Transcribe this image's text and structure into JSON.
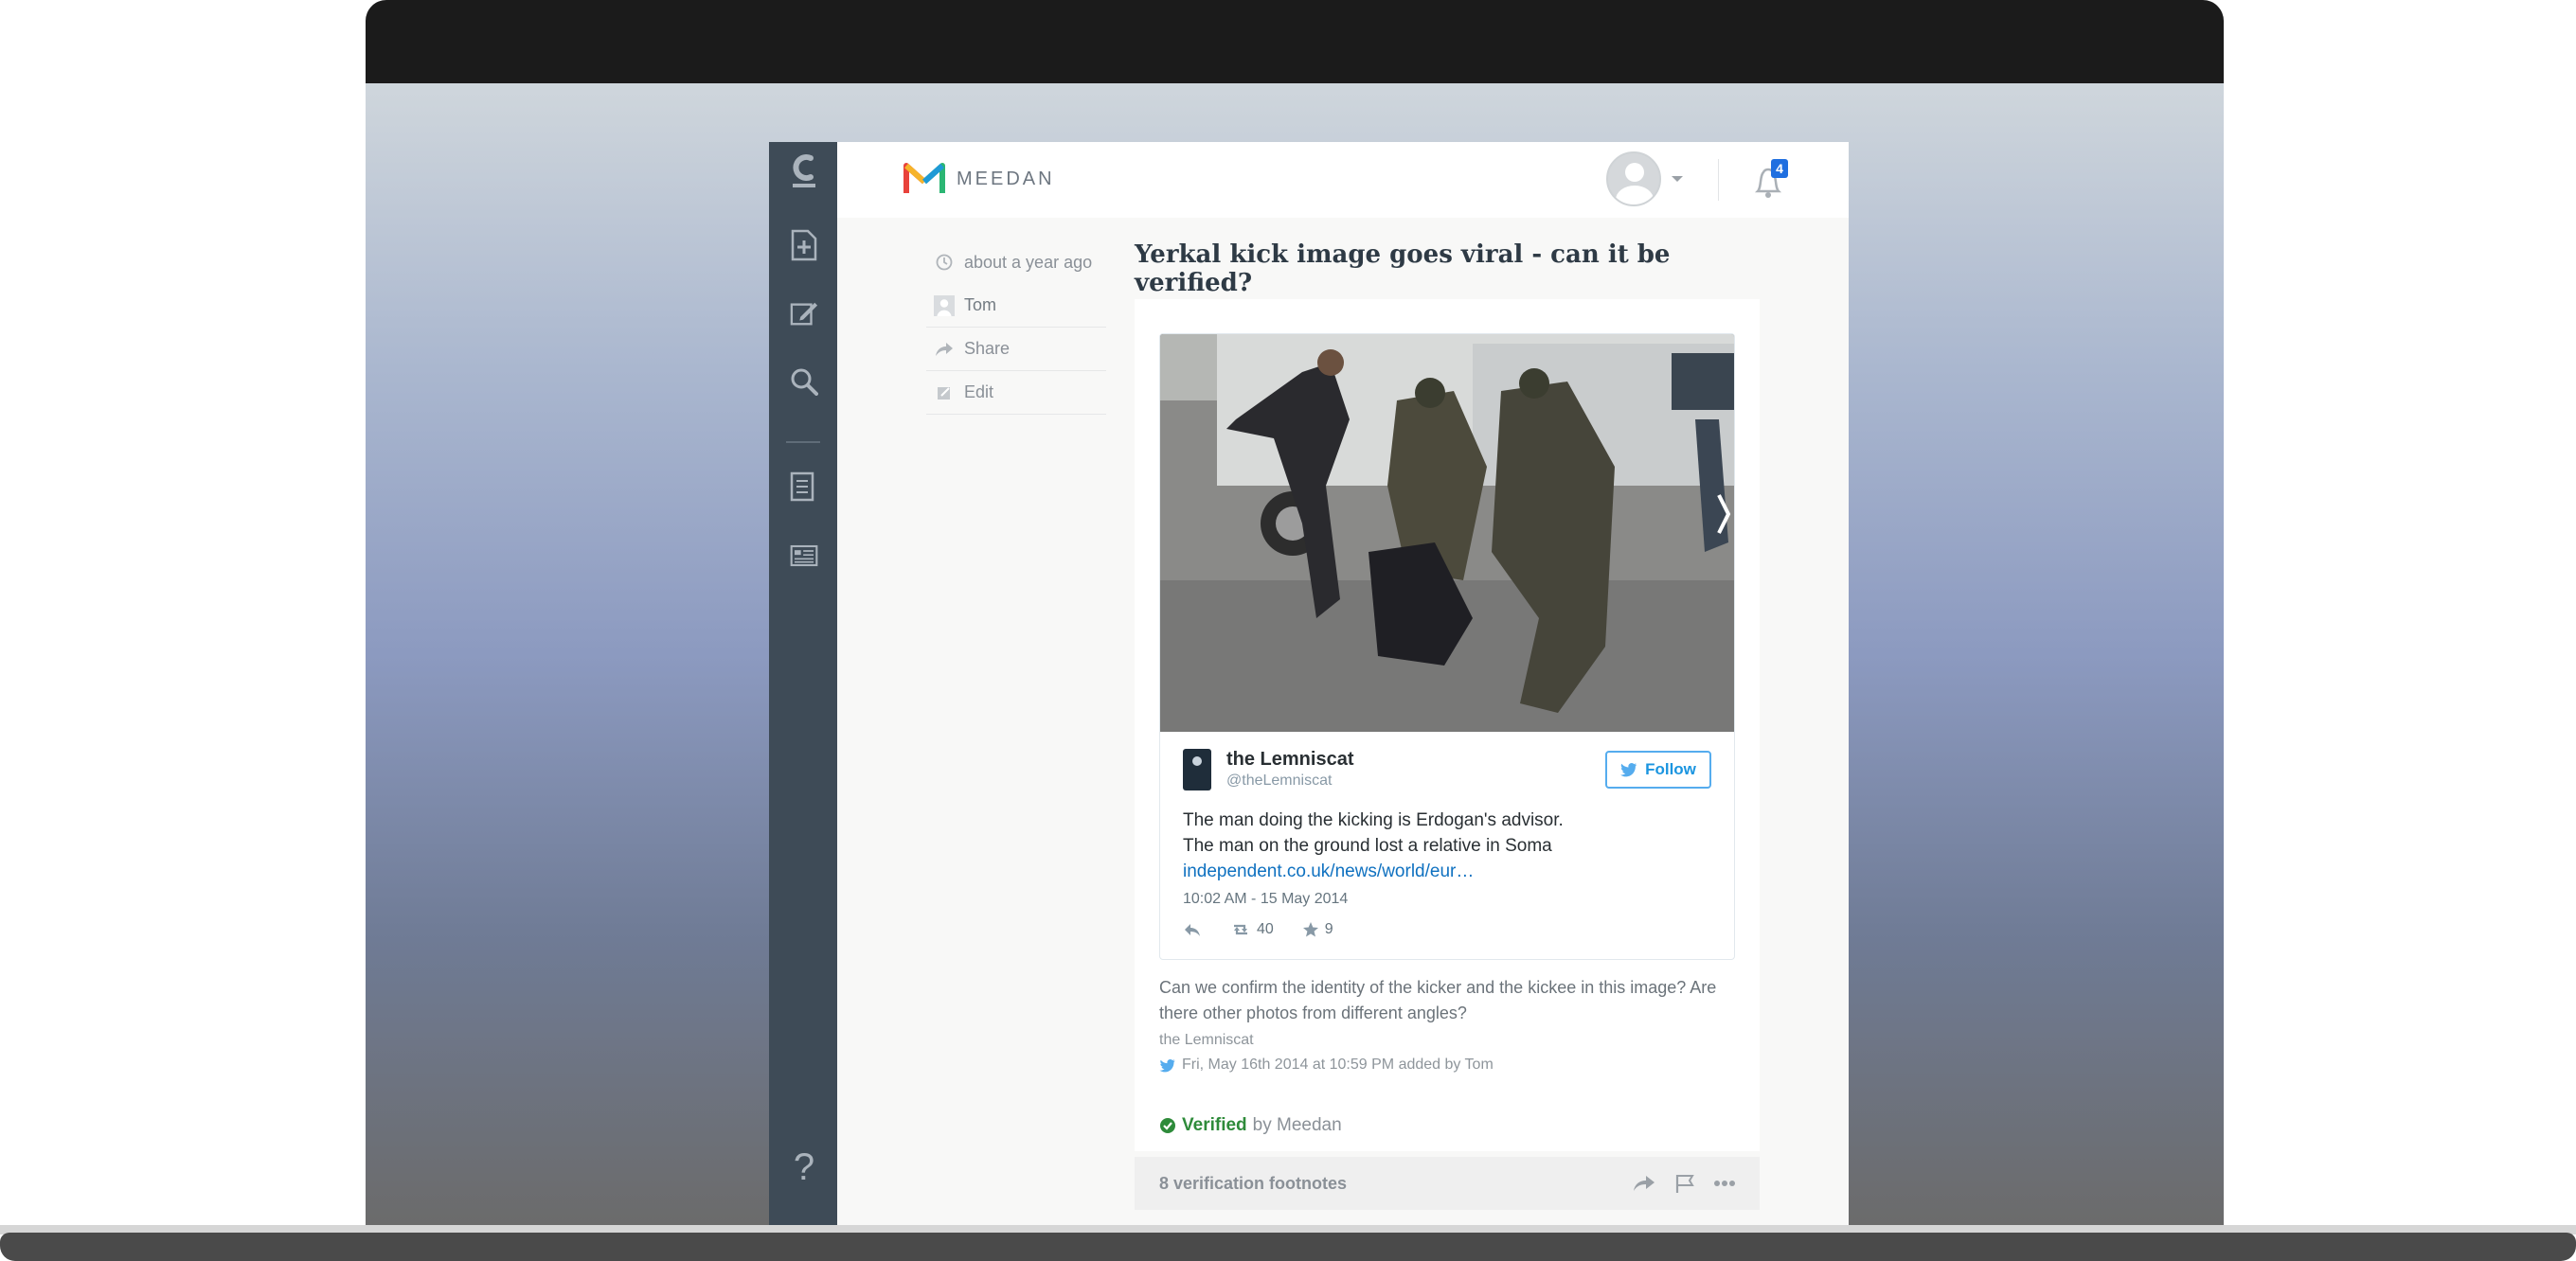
{
  "app": {
    "brand": "MEEDAN",
    "notifications_count": "4"
  },
  "rail": {
    "icons": [
      "check-logo-icon",
      "new-post-icon",
      "compose-icon",
      "search-icon",
      "document-icon",
      "newspaper-icon",
      "help-icon"
    ],
    "help_label": "?"
  },
  "meta": {
    "time": "about a year ago",
    "author": "Tom",
    "share": "Share",
    "edit": "Edit"
  },
  "post": {
    "title": "Yerkal kick image goes viral - can it be verified?"
  },
  "tweet": {
    "name": "the Lemniscat",
    "handle": "@theLemniscat",
    "follow_label": "Follow",
    "text_line1": "The man doing the kicking is Erdogan's advisor.",
    "text_line2": "The man on the ground lost a relative in Soma",
    "link": "independent.co.uk/news/world/eur…",
    "timestamp": "10:02 AM - 15 May 2014",
    "retweets": "40",
    "favorites": "9"
  },
  "claim": {
    "text": "Can we confirm the identity of the kicker and the kickee in this image? Are there other photos from different angles?",
    "source": "the Lemniscat",
    "added": "Fri, May 16th 2014 at 10:59 PM added by Tom"
  },
  "status": {
    "label": "Verified",
    "by": "by Meedan",
    "color": "#2e8b3a"
  },
  "footnotes": {
    "count_label": "8 verification footnotes"
  },
  "colors": {
    "rail": "#3e4b57",
    "twitter_blue": "#55acee",
    "badge": "#1f6fe0"
  }
}
